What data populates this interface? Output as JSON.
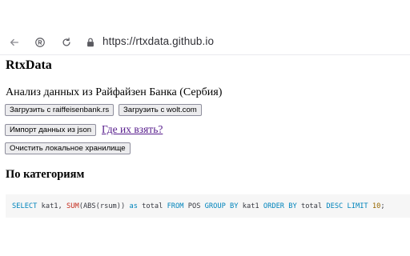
{
  "browser": {
    "url": "https://rtxdata.github.io"
  },
  "page": {
    "title": "RtxData",
    "subtitle": "Анализ данных из Райфайзен Банка (Сербия)",
    "buttons": {
      "load_raiffeisen": "Загрузить с raiffeisenbank.rs",
      "load_wolt": "Загрузить с wolt.com",
      "import_json": "Импорт данных из json",
      "clear_storage": "Очистить локальное хранилище"
    },
    "where_link": "Где их взять?",
    "section_title": "По категориям",
    "query": {
      "select_kw": "SELECT",
      "col1": " kat1, ",
      "sum_fn": "SUM",
      "abs_part": "(ABS(rsum)) ",
      "as_kw": "as",
      "total1": " total ",
      "from_kw": "FROM",
      "table": " POS ",
      "group_kw": "GROUP BY",
      "col2": " kat1 ",
      "order_kw": "ORDER BY",
      "total2": " total ",
      "desc_kw": "DESC",
      "space1": " ",
      "limit_kw": "LIMIT",
      "space2": " ",
      "limit_val": "10",
      "semi": ";"
    }
  }
}
